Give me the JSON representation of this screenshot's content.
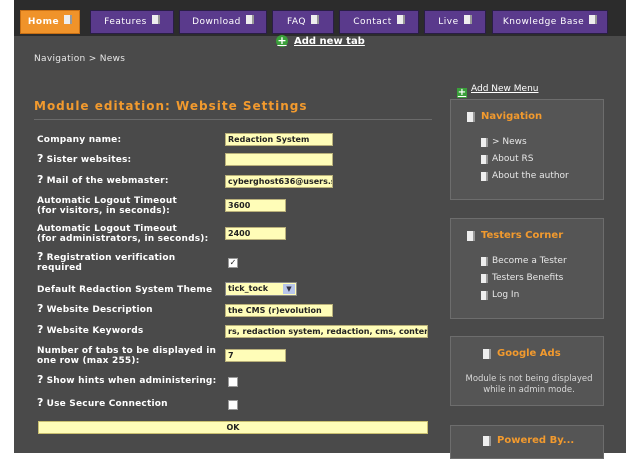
{
  "tabs": [
    {
      "label": "Home",
      "active": true
    },
    {
      "label": "Features"
    },
    {
      "label": "Download"
    },
    {
      "label": "FAQ"
    },
    {
      "label": "Contact"
    },
    {
      "label": "Live"
    },
    {
      "label": "Knowledge Base"
    }
  ],
  "add_tab_label": "Add new tab",
  "breadcrumb": "Navigation > News",
  "add_menu_label": "Add New Menu",
  "module_title": "Module editation: Website Settings",
  "form": {
    "company_name": {
      "label": "Company name:",
      "value": "Redaction System"
    },
    "sister_websites": {
      "label": "Sister websites:",
      "value": ""
    },
    "webmaster_mail": {
      "label": "Mail of the webmaster:",
      "value": "cyberghost636@users.s"
    },
    "logout_visitors": {
      "label1": "Automatic Logout Timeout",
      "label2": "(for visitors, in seconds):",
      "value": "3600"
    },
    "logout_admins": {
      "label1": "Automatic Logout Timeout",
      "label2": "(for administrators, in seconds):",
      "value": "2400"
    },
    "registration_verification": {
      "label1": "Registration verification",
      "label2": "required",
      "checked": true
    },
    "theme": {
      "label": "Default Redaction System Theme",
      "value": "tick_tock"
    },
    "website_description": {
      "label": "Website Description",
      "value": "the CMS (r)evolution"
    },
    "website_keywords": {
      "label": "Website Keywords",
      "value": "rs, redaction system, redaction, cms, conten"
    },
    "tabs_per_row": {
      "label1": "Number of tabs to be displayed in",
      "label2": "one row (max 255):",
      "value": "7"
    },
    "show_hints": {
      "label": "Show hints when administering:",
      "checked": false
    },
    "secure_connection": {
      "label": "Use Secure Connection",
      "checked": false
    },
    "ok_label": "OK",
    "hint_mark": "?"
  },
  "sidebar": {
    "navigation": {
      "title": "Navigation",
      "items": [
        "> News",
        "About RS",
        "About the author"
      ]
    },
    "testers": {
      "title": "Testers Corner",
      "items": [
        "Become a Tester",
        "Testers Benefits",
        "Log In"
      ]
    },
    "ads": {
      "title": "Google Ads",
      "text": "Module is not being displayed while in admin mode."
    },
    "powered": {
      "title": "Powered By..."
    }
  },
  "colors": {
    "accent": "#f29a2e",
    "tab": "#5a3a8c",
    "active_tab": "#f0932a",
    "field": "#fffdb8",
    "background": "#4a4a4a"
  }
}
